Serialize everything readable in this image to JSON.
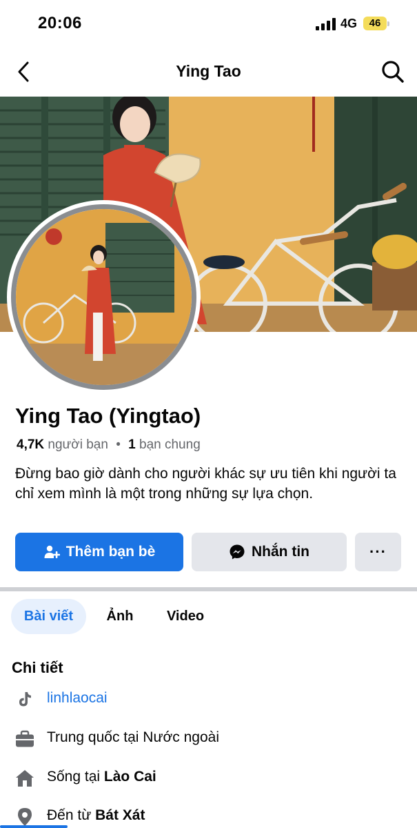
{
  "status_bar": {
    "time": "20:06",
    "network": "4G",
    "battery": "46"
  },
  "header": {
    "title": "Ying Tao",
    "back_icon": "chevron-left-icon",
    "search_icon": "search-icon"
  },
  "profile": {
    "name": "Ying Tao (Yingtao)",
    "friends_count": "4,7K",
    "friends_label": "người bạn",
    "separator": "•",
    "mutual_count": "1",
    "mutual_label": "bạn chung",
    "bio": "Đừng bao giờ dành cho người khác sự ưu tiên khi người ta chỉ xem mình là một trong những sự lựa chọn."
  },
  "actions": {
    "add_friend_label": "Thêm bạn bè",
    "message_label": "Nhắn tin",
    "more_label": "···"
  },
  "tabs": [
    {
      "label": "Bài viết",
      "active": true
    },
    {
      "label": "Ảnh",
      "active": false
    },
    {
      "label": "Video",
      "active": false
    }
  ],
  "details": {
    "title": "Chi tiết",
    "items": [
      {
        "icon": "tiktok-icon",
        "text": "linhlaocai",
        "is_link": true
      },
      {
        "icon": "briefcase-icon",
        "text": "Trung quốc tại Nước ngoài"
      },
      {
        "icon": "home-icon",
        "prefix": "Sống tại ",
        "bold": "Lào Cai"
      },
      {
        "icon": "location-pin-icon",
        "prefix": "Đến từ ",
        "bold": "Bát Xát"
      }
    ]
  },
  "colors": {
    "accent": "#1b74e4",
    "secondary_button": "#e4e6eb",
    "muted_text": "#65676b",
    "cover_wall": "#e0a445",
    "shutter_green": "#3e5a48",
    "dress_red": "#d2452f"
  }
}
